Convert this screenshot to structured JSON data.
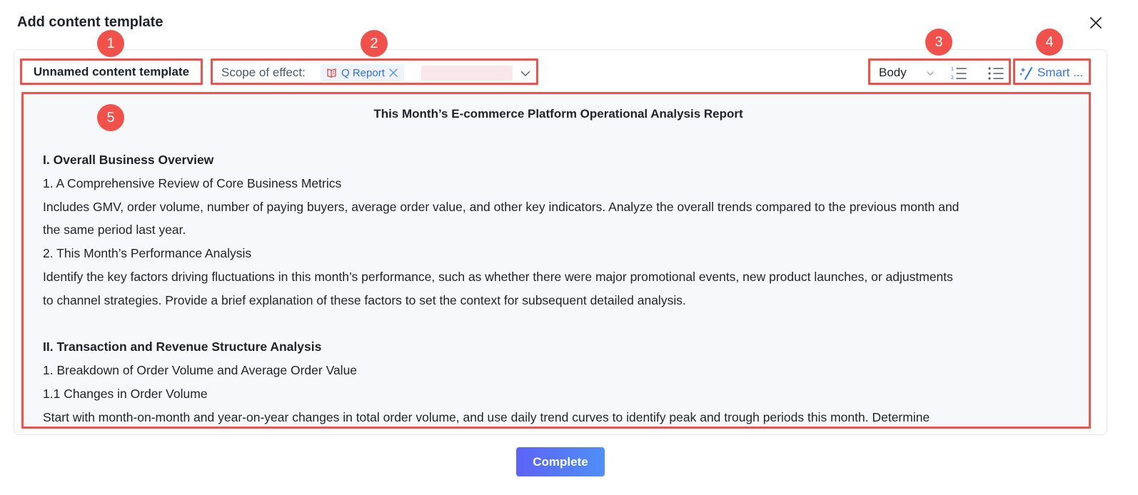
{
  "dialog": {
    "title": "Add content template"
  },
  "template_name": "Unnamed content template",
  "scope": {
    "label": "Scope of effect:",
    "chip_label": "Q Report"
  },
  "format": {
    "style_value": "Body"
  },
  "smart": {
    "label": "Smart ..."
  },
  "badges": [
    "1",
    "2",
    "3",
    "4",
    "5"
  ],
  "document": {
    "title": "This Month’s E-commerce Platform Operational Analysis Report",
    "lines": [
      {
        "text": "I. Overall Business Overview",
        "bold": true
      },
      {
        "text": "1. A Comprehensive Review of Core Business Metrics",
        "bold": false
      },
      {
        "text": "Includes GMV, order volume, number of paying buyers, average order value, and other key indicators. Analyze the overall trends compared to the previous month and",
        "bold": false
      },
      {
        "text": "the same period last year.",
        "bold": false
      },
      {
        "text": "2. This Month’s Performance Analysis",
        "bold": false
      },
      {
        "text": "Identify the key factors driving fluctuations in this month’s performance, such as whether there were major promotional events, new product launches, or adjustments",
        "bold": false
      },
      {
        "text": "to channel strategies. Provide a brief explanation of these factors to set the context for subsequent detailed analysis.",
        "bold": false
      },
      {
        "text": "",
        "bold": false
      },
      {
        "text": "II. Transaction and Revenue Structure Analysis",
        "bold": true
      },
      {
        "text": "1. Breakdown of Order Volume and Average Order Value",
        "bold": false
      },
      {
        "text": "1.1 Changes in Order Volume",
        "bold": false
      },
      {
        "text": "Start with month-on-month and year-on-year changes in total order volume, and use daily trend curves to identify peak and trough periods this month. Determine",
        "bold": false
      }
    ]
  },
  "footer": {
    "complete_label": "Complete"
  },
  "colors": {
    "highlight": "#f0514a",
    "primary": "#3370ff",
    "chip_bg": "#eef3fd"
  }
}
